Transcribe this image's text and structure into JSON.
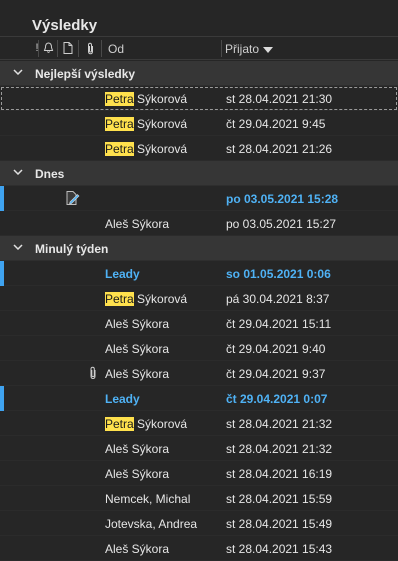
{
  "title": "Výsledky",
  "columns": {
    "from": "Od",
    "received": "Přijato"
  },
  "groups": [
    {
      "label": "Nejlepší výsledky",
      "rows": [
        {
          "highlight": "Petra",
          "rest": " Sýkorová",
          "date": "st 28.04.2021 21:30",
          "focused": true
        },
        {
          "highlight": "Petra",
          "rest": " Sýkorová",
          "date": "čt 29.04.2021 9:45"
        },
        {
          "highlight": "Petra",
          "rest": " Sýkorová",
          "date": "st 28.04.2021 21:26"
        }
      ]
    },
    {
      "label": "Dnes",
      "rows": [
        {
          "highlight": "",
          "rest": "",
          "date": "po 03.05.2021 15:28",
          "unread": true,
          "draft_icon": true
        },
        {
          "highlight": "",
          "rest": "Aleš Sýkora",
          "date": "po 03.05.2021 15:27"
        }
      ]
    },
    {
      "label": "Minulý týden",
      "rows": [
        {
          "highlight": "",
          "rest": "Leady",
          "date": "so 01.05.2021 0:06",
          "unread": true
        },
        {
          "highlight": "Petra",
          "rest": " Sýkorová",
          "date": "pá 30.04.2021 8:37"
        },
        {
          "highlight": "",
          "rest": "Aleš Sýkora",
          "date": "čt 29.04.2021 15:11"
        },
        {
          "highlight": "",
          "rest": "Aleš Sýkora",
          "date": "čt 29.04.2021 9:40"
        },
        {
          "highlight": "",
          "rest": "Aleš Sýkora",
          "date": "čt 29.04.2021 9:37",
          "attachment": true
        },
        {
          "highlight": "",
          "rest": "Leady",
          "date": "čt 29.04.2021 0:07",
          "unread": true
        },
        {
          "highlight": "Petra",
          "rest": " Sýkorová",
          "date": "st 28.04.2021 21:32"
        },
        {
          "highlight": "",
          "rest": "Aleš Sýkora",
          "date": "st 28.04.2021 21:32"
        },
        {
          "highlight": "",
          "rest": "Aleš Sýkora",
          "date": "st 28.04.2021 16:19"
        },
        {
          "highlight": "",
          "rest": "Nemcek, Michal",
          "date": "st 28.04.2021 15:59"
        },
        {
          "highlight": "",
          "rest": "Jotevska, Andrea",
          "date": "st 28.04.2021 15:49"
        },
        {
          "highlight": "",
          "rest": "Aleš Sýkora",
          "date": "st 28.04.2021 15:43"
        }
      ]
    }
  ],
  "colors": {
    "unread": "#4fb2f5",
    "highlight": "#ffe14d",
    "group_bg": "#363636",
    "background": "#262626"
  }
}
